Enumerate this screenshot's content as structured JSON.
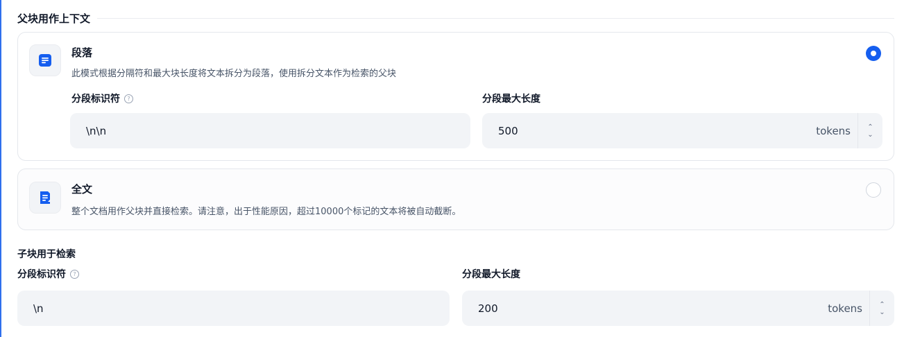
{
  "parent_section": {
    "title": "父块用作上下文",
    "paragraph_option": {
      "icon": "paragraph-icon",
      "title": "段落",
      "description": "此模式根据分隔符和最大块长度将文本拆分为段落，使用拆分文本作为检索的父块",
      "selected": true,
      "delimiter_label": "分段标识符",
      "delimiter_value": "\\n\\n",
      "max_length_label": "分段最大长度",
      "max_length_value": "500",
      "unit": "tokens"
    },
    "fulltext_option": {
      "icon": "document-icon",
      "title": "全文",
      "description": "整个文档用作父块并直接检索。请注意，出于性能原因，超过10000个标记的文本将被自动截断。",
      "selected": false
    }
  },
  "child_section": {
    "title": "子块用于检索",
    "delimiter_label": "分段标识符",
    "delimiter_value": "\\n",
    "max_length_label": "分段最大长度",
    "max_length_value": "200",
    "unit": "tokens"
  },
  "colors": {
    "accent": "#155eef",
    "field_bg": "#f2f4f7",
    "border": "#e4e7ec"
  }
}
